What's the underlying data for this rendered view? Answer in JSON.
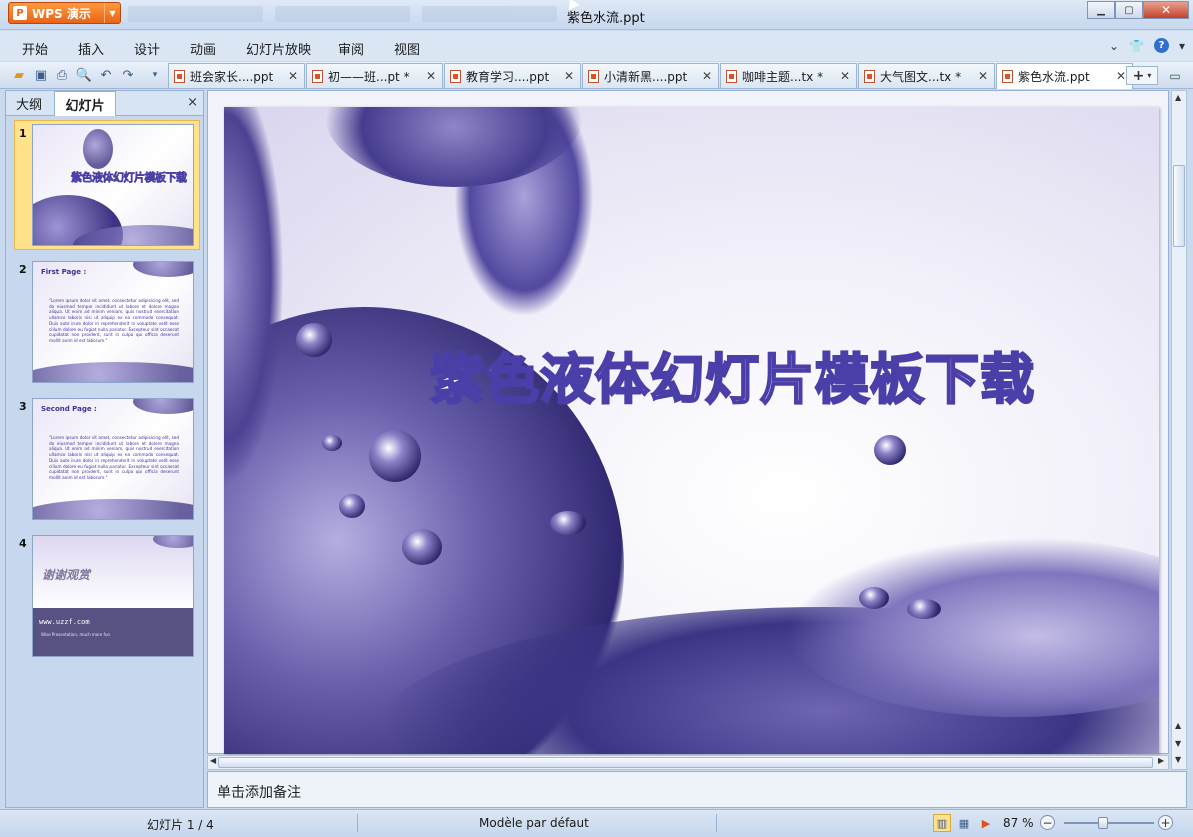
{
  "app": {
    "brand": "WPS 演示",
    "window_title": "紫色水流.ppt"
  },
  "menu": [
    "开始",
    "插入",
    "设计",
    "动画",
    "幻灯片放映",
    "审阅",
    "视图"
  ],
  "doc_tabs": [
    {
      "label": "班会家长....ppt",
      "active": false
    },
    {
      "label": "初——班...pt *",
      "active": false
    },
    {
      "label": "教育学习....ppt",
      "active": false
    },
    {
      "label": "小清新黑....ppt",
      "active": false
    },
    {
      "label": "咖啡主题...tx *",
      "active": false
    },
    {
      "label": "大气图文...tx *",
      "active": false
    },
    {
      "label": "紫色水流.ppt",
      "active": true
    }
  ],
  "panel": {
    "tab_outline": "大纲",
    "tab_slides": "幻灯片",
    "close": "×"
  },
  "slides": [
    {
      "num": "1",
      "title": "紫色液体幻灯片模板下载"
    },
    {
      "num": "2",
      "heading": "First Page :",
      "body": "\"Lorem ipsum dolor sit amet, consectetur adipisicing elit, sed do eiusmod tempor incididunt ut labore et dolore magna aliqua. Ut enim ad minim veniam, quis nostrud exercitation ullamco laboris nisi ut aliquip ex ea commodo consequat. Duis aute irure dolor in reprehenderit in voluptate velit esse cillum dolore eu fugiat nulla pariatur. Excepteur sint occaecat cupidatat non proident, sunt in culpa qui officia deserunt mollit anim id est laborum.\""
    },
    {
      "num": "3",
      "heading": "Second Page :",
      "body": "\"Lorem ipsum dolor sit amet, consectetur adipisicing elit, sed do eiusmod tempor incididunt ut labore et dolore magna aliqua. Ut enim ad minim veniam, quis nostrud exercitation ullamco laboris nisi ut aliquip ex ea commodo consequat. Duis aute irure dolor in reprehenderit in voluptate velit esse cillum dolore eu fugiat nulla pariatur. Excepteur sint occaecat cupidatat non proident, sunt in culpa qui officia deserunt mollit anim id est laborum.\""
    },
    {
      "num": "4",
      "thanks": "谢谢观赏",
      "url": "www.uzzf.com",
      "small": "Wise Presentation, much more fun"
    }
  ],
  "main_slide": {
    "title": "紫色液体幻灯片模板下载"
  },
  "notes_placeholder": "单击添加备注",
  "status": {
    "slide_pos": "幻灯片 1 / 4",
    "template": "Modèle par défaut",
    "zoom": "87 %",
    "zoom_level": 0.42
  },
  "colors": {
    "accent": "#e8631a",
    "purple": "#4a3fa8"
  }
}
